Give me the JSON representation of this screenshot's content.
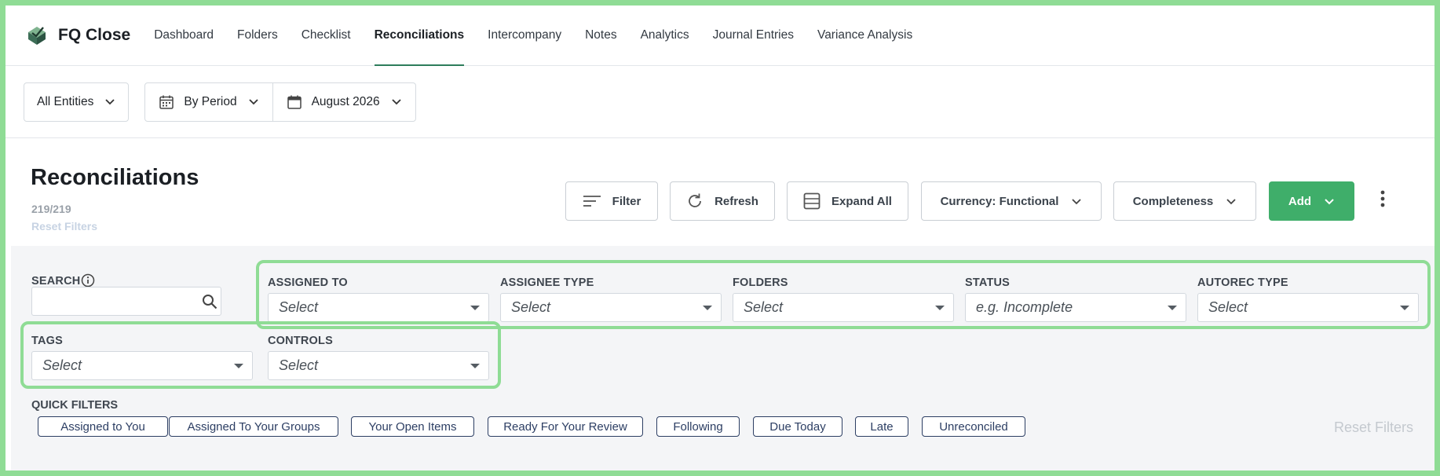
{
  "app": {
    "name": "FQ Close"
  },
  "nav": {
    "tabs": [
      {
        "label": "Dashboard"
      },
      {
        "label": "Folders"
      },
      {
        "label": "Checklist"
      },
      {
        "label": "Reconciliations"
      },
      {
        "label": "Intercompany"
      },
      {
        "label": "Notes"
      },
      {
        "label": "Analytics"
      },
      {
        "label": "Journal Entries"
      },
      {
        "label": "Variance Analysis"
      }
    ],
    "active": "Reconciliations"
  },
  "period": {
    "entity": "All Entities",
    "mode": "By Period",
    "month": "August 2026"
  },
  "header": {
    "title": "Reconciliations",
    "count": "219/219",
    "reset_filters": "Reset Filters"
  },
  "toolbar": {
    "filter": "Filter",
    "refresh": "Refresh",
    "expand_all": "Expand All",
    "currency": "Currency: Functional",
    "completeness": "Completeness",
    "add": "Add"
  },
  "filters": {
    "search_label": "SEARCH",
    "search_value": "",
    "assigned_to": {
      "label": "ASSIGNED TO",
      "placeholder": "Select"
    },
    "assignee_type": {
      "label": "ASSIGNEE TYPE",
      "placeholder": "Select"
    },
    "folders": {
      "label": "FOLDERS",
      "placeholder": "Select"
    },
    "status": {
      "label": "STATUS",
      "placeholder": "e.g. Incomplete"
    },
    "autorec_type": {
      "label": "AUTOREC TYPE",
      "placeholder": "Select"
    },
    "tags": {
      "label": "TAGS",
      "placeholder": "Select"
    },
    "controls": {
      "label": "CONTROLS",
      "placeholder": "Select"
    }
  },
  "quick_filters": {
    "title": "QUICK FILTERS",
    "items": [
      {
        "label": "Assigned to You"
      },
      {
        "label": "Assigned To Your Groups"
      },
      {
        "label": "Your Open Items"
      },
      {
        "label": "Ready For Your Review"
      },
      {
        "label": "Following"
      },
      {
        "label": "Due Today"
      },
      {
        "label": "Late"
      },
      {
        "label": "Unreconciled"
      }
    ],
    "reset": "Reset Filters"
  },
  "colors": {
    "accent": "#2e7d5b",
    "add_button": "#3fae6a",
    "highlight": "#8fdc95",
    "chip_border": "#2c3e63"
  }
}
